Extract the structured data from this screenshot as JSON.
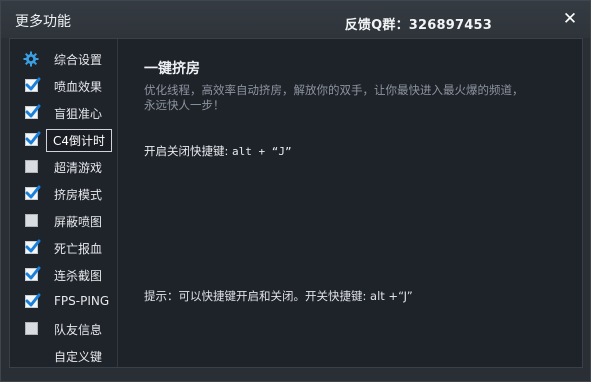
{
  "window": {
    "title": "更多功能",
    "contact": "反馈Q群：326897453",
    "close_glyph": "✕"
  },
  "sidebar": {
    "items": [
      {
        "label": "综合设置",
        "icon": "gear-icon",
        "state": "icon"
      },
      {
        "label": "喷血效果",
        "state": "checked"
      },
      {
        "label": "盲狙准心",
        "state": "checked"
      },
      {
        "label": "C4倒计时",
        "state": "checked",
        "active": true
      },
      {
        "label": "超清游戏",
        "state": "unchecked"
      },
      {
        "label": "挤房模式",
        "state": "checked"
      },
      {
        "label": "屏蔽喷图",
        "state": "unchecked"
      },
      {
        "label": "死亡报血",
        "state": "checked"
      },
      {
        "label": "连杀截图",
        "state": "checked"
      },
      {
        "label": "FPS-PING",
        "state": "checked"
      },
      {
        "label": "队友信息",
        "state": "unchecked"
      },
      {
        "label": "自定义键",
        "state": "none"
      }
    ]
  },
  "main": {
    "heading": "一键挤房",
    "description": "优化线程，高效率自动挤房，解放你的双手，让你最快进入最火爆的频道，永远快人一步！",
    "hotkey_label": "开启关闭快捷键:",
    "hotkey_value": "alt + “J”",
    "tip": "提示：可以快捷键开启和关闭。开关快捷键: alt +“J”"
  },
  "colors": {
    "window_bg": "#2a2f35",
    "panel_bg": "#1e2229",
    "check_blue": "#1a7fd8",
    "gear_blue": "#3aa0e6"
  }
}
